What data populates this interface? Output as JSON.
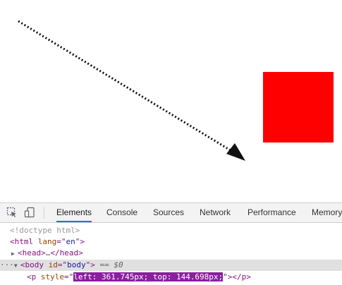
{
  "page": {
    "box_color": "#ff0000",
    "arrow_color": "#111111"
  },
  "devtools": {
    "tabs": [
      "Elements",
      "Console",
      "Sources",
      "Network",
      "Performance",
      "Memory"
    ],
    "active_tab": "Elements",
    "tree": {
      "doctype": "<!doctype html>",
      "html_open": "<html",
      "html_attr_name": "lang",
      "html_attr_eq": "=\"",
      "html_attr_val": "en",
      "html_close": "\">",
      "head_open": "<head>",
      "head_ellipsis": "…",
      "head_close": "</head>",
      "body_dots": "···",
      "body_open": "<body",
      "body_attr_name": "id",
      "body_attr_eq": "=\"",
      "body_attr_val": "body",
      "body_close": "\">",
      "body_marker": " == $0",
      "p_open": "<p",
      "p_attr_name": "style",
      "p_attr_eq": "=\"",
      "p_attr_val": "left: 361.745px; top: 144.698px;",
      "p_close": "\"></p>"
    }
  }
}
